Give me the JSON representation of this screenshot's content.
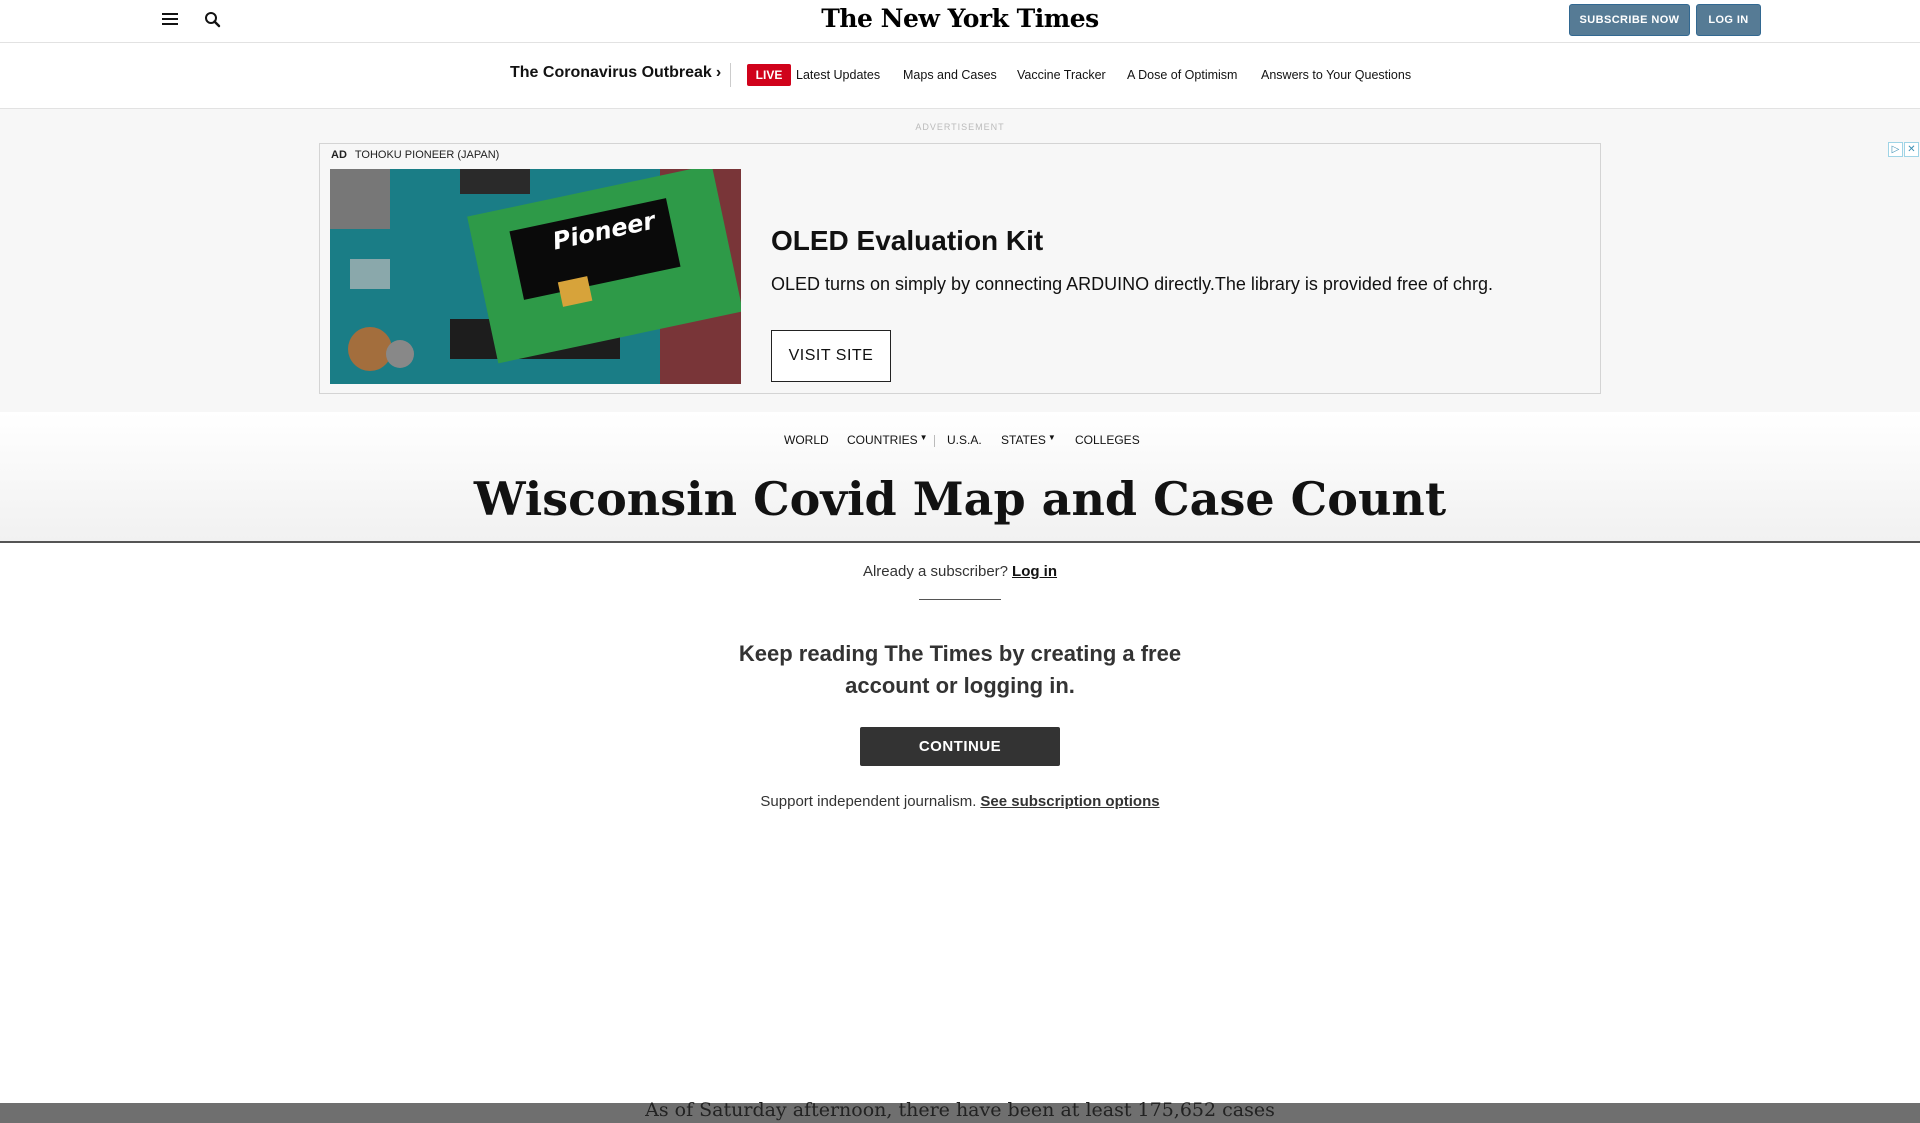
{
  "masthead": {
    "logo": "The New York Times",
    "subscribe_label": "SUBSCRIBE NOW",
    "login_label": "LOG IN",
    "menu_icon": "hamburger-menu-icon",
    "search_icon": "search-icon"
  },
  "covid_nav": {
    "title": "The Coronavirus Outbreak",
    "live_badge": "LIVE",
    "links": [
      "Latest Updates",
      "Maps and Cases",
      "Vaccine Tracker",
      "A Dose of Optimism",
      "Answers to Your Questions"
    ]
  },
  "ad": {
    "label": "ADVERTISEMENT",
    "ad_tag": "AD",
    "advertiser": "TOHOKU PIONEER (JAPAN)",
    "headline": "OLED Evaluation Kit",
    "body": "OLED turns on simply by connecting ARDUINO directly.The library is provided free of chrg.",
    "cta": "VISIT SITE",
    "image_brand_text": "Pioneer",
    "adchoices_icon": "adchoices-icon",
    "close_icon": "close-icon"
  },
  "section_nav": {
    "items": [
      "WORLD",
      "COUNTRIES",
      "U.S.A.",
      "STATES",
      "COLLEGES"
    ]
  },
  "page_title": "Wisconsin Covid Map and Case Count",
  "paywall": {
    "already_text": "Already a subscriber?",
    "login_link": "Log in",
    "headline_line1": "Keep reading The Times by creating a free",
    "headline_line2": "account or logging in.",
    "continue_label": "CONTINUE",
    "support_text": "Support independent journalism.",
    "subscription_link": "See subscription options"
  },
  "article_snippet": "As of Saturday afternoon, there have been at least 175,652 cases",
  "colors": {
    "subscribe_button": "#567b95",
    "live_badge": "#d0021b",
    "continue_button": "#333333"
  }
}
